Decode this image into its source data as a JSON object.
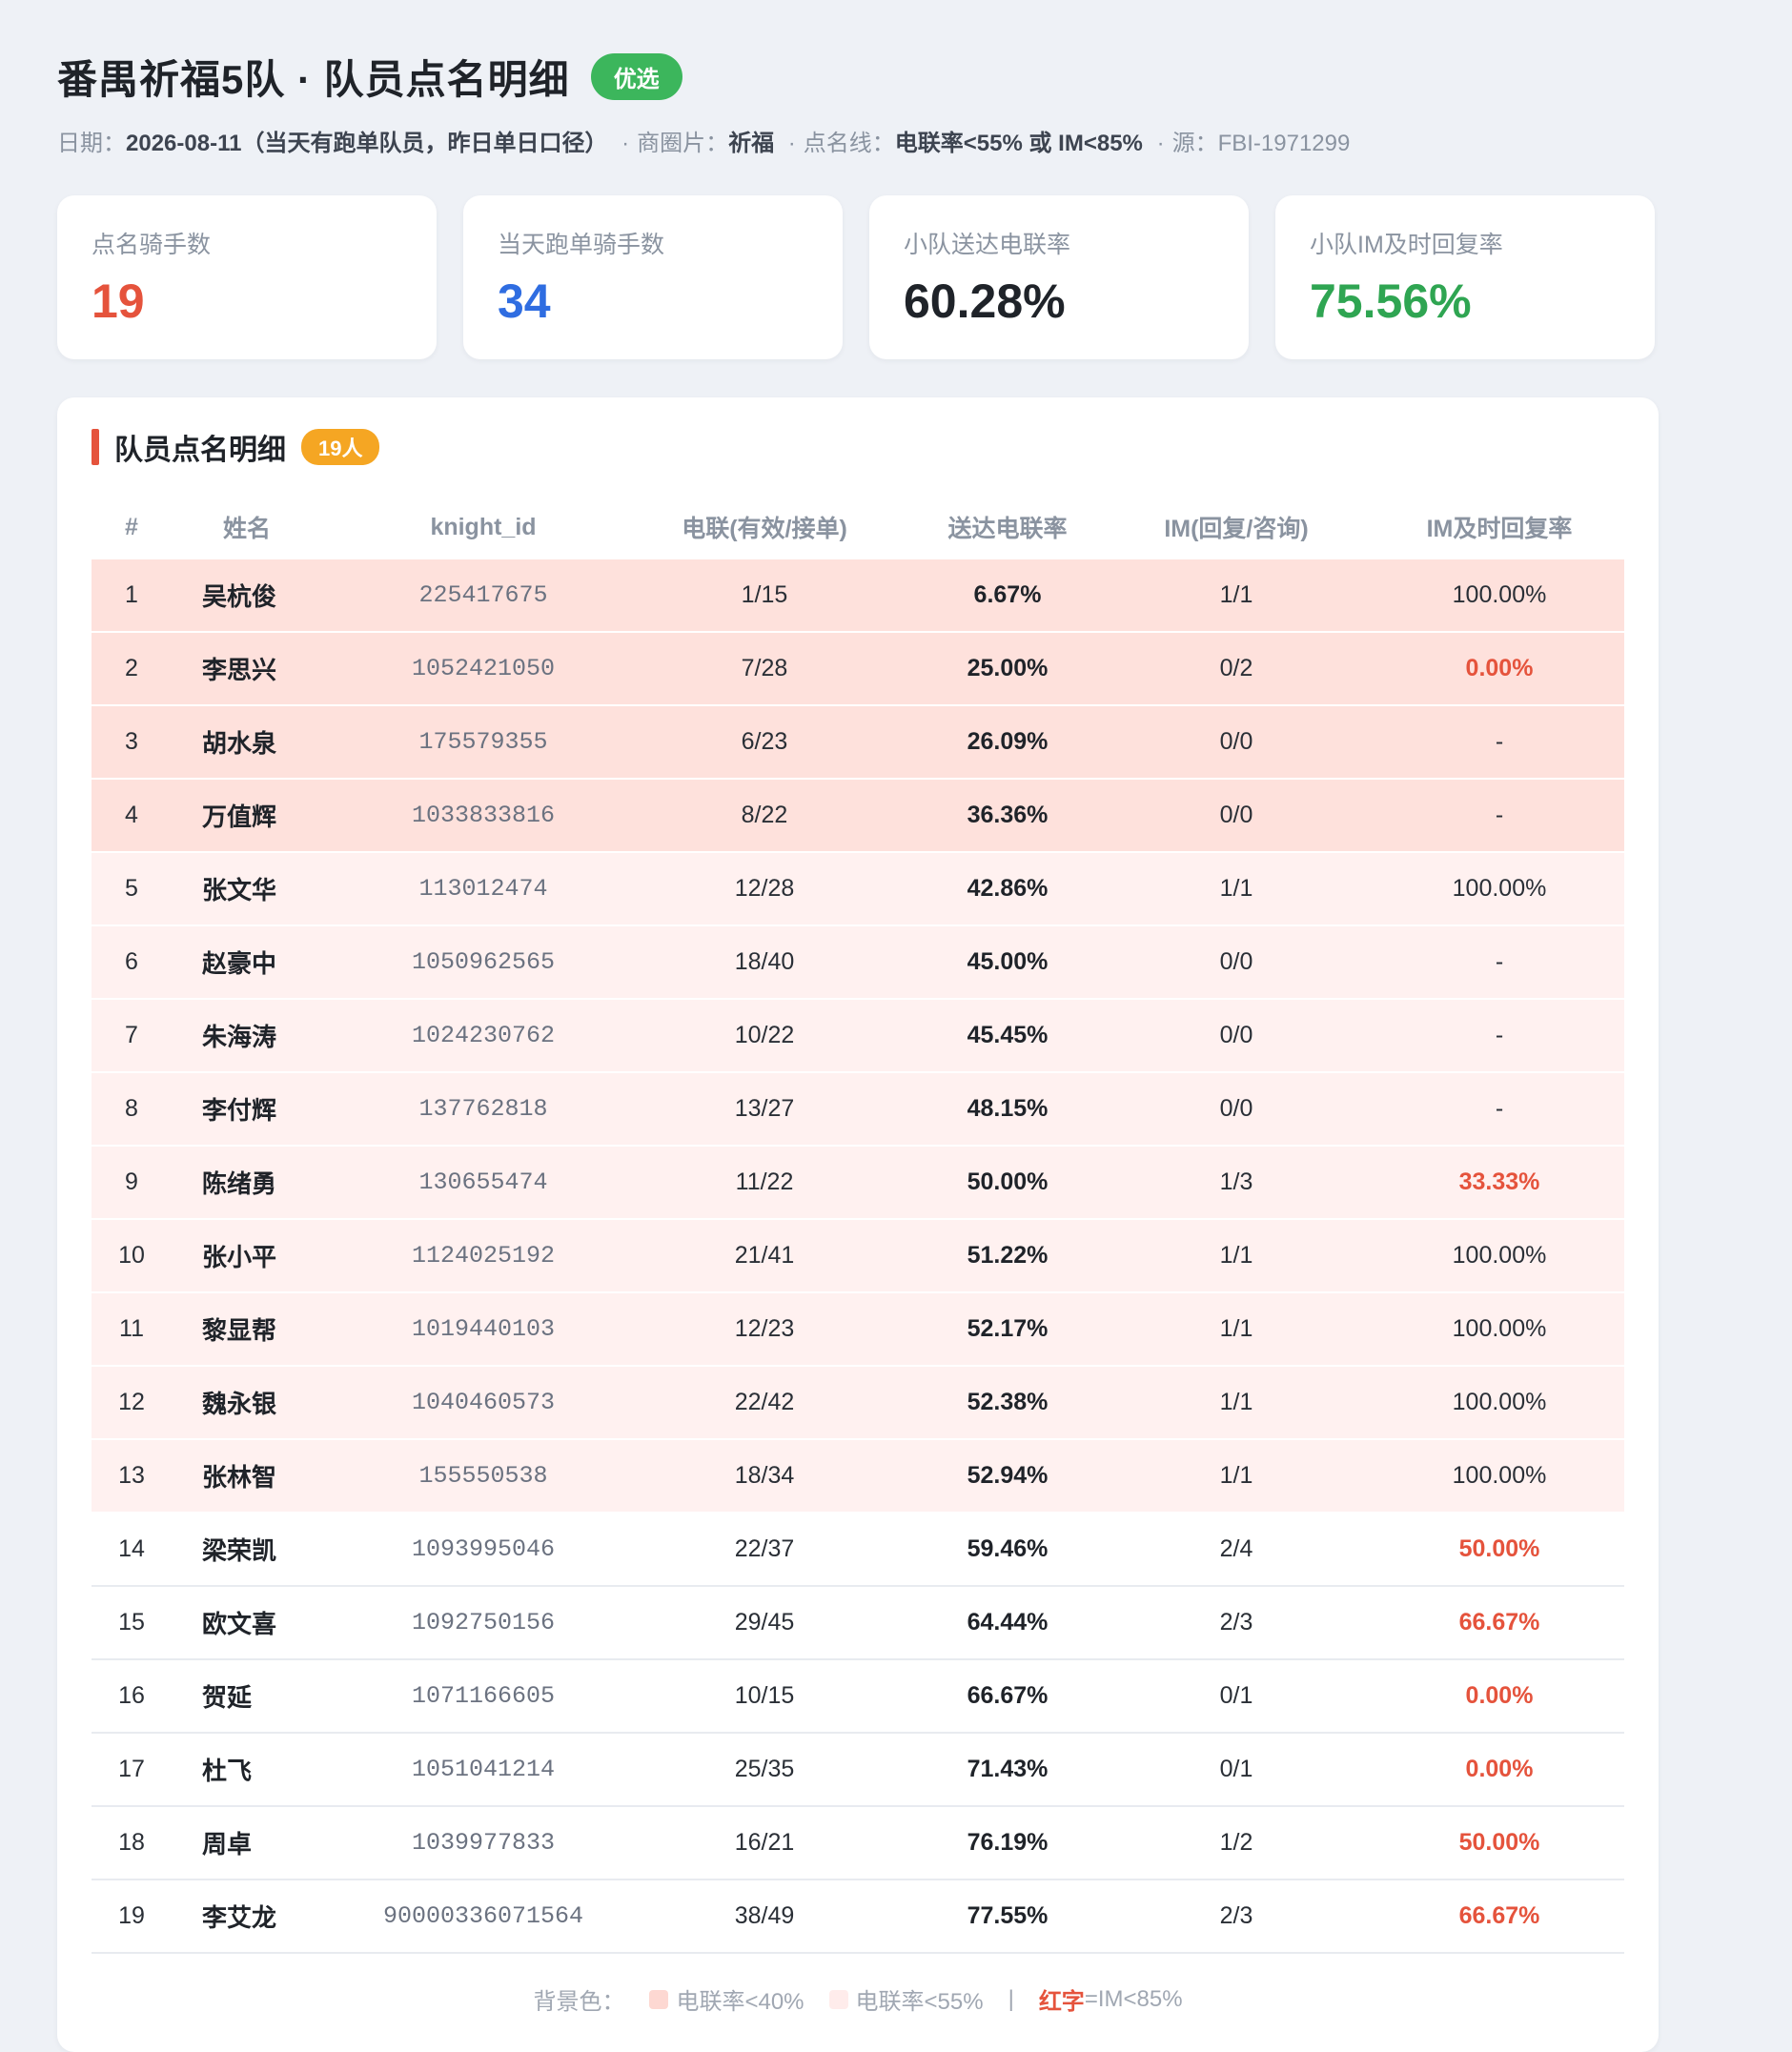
{
  "header": {
    "title": "番禺祈福5队 · 队员点名明细",
    "badge": "优选",
    "meta": {
      "date_label": "日期：",
      "date_value": "2026-08-11（当天有跑单队员，昨日单日口径）",
      "area_label": "商圈片：",
      "area_value": "祈福",
      "threshold_label": "点名线：",
      "threshold_value": "电联率<55% 或 IM<85%",
      "source_label": "源：",
      "source_value": "FBI-1971299",
      "separator": "·"
    }
  },
  "cards": [
    {
      "label": "点名骑手数",
      "value": "19",
      "color": "#e5533c"
    },
    {
      "label": "当天跑单骑手数",
      "value": "34",
      "color": "#2f6de1"
    },
    {
      "label": "小队送达电联率",
      "value": "60.28%",
      "color": "#1f2329"
    },
    {
      "label": "小队IM及时回复率",
      "value": "75.56%",
      "color": "#2fa552"
    }
  ],
  "panel": {
    "title": "队员点名明细",
    "count_badge": "19人",
    "columns": [
      "#",
      "姓名",
      "knight_id",
      "电联(有效/接单)",
      "送达电联率",
      "IM(回复/咨询)",
      "IM及时回复率"
    ],
    "rows": [
      {
        "no": "1",
        "name": "吴杭俊",
        "knight_id": "225417675",
        "call": "1/15",
        "call_rate": "6.67%",
        "im": "1/1",
        "im_rate": "100.00%",
        "bg": "red",
        "im_warn": false
      },
      {
        "no": "2",
        "name": "李思兴",
        "knight_id": "1052421050",
        "call": "7/28",
        "call_rate": "25.00%",
        "im": "0/2",
        "im_rate": "0.00%",
        "bg": "red",
        "im_warn": true
      },
      {
        "no": "3",
        "name": "胡水泉",
        "knight_id": "175579355",
        "call": "6/23",
        "call_rate": "26.09%",
        "im": "0/0",
        "im_rate": "-",
        "bg": "red",
        "im_warn": false
      },
      {
        "no": "4",
        "name": "万值辉",
        "knight_id": "1033833816",
        "call": "8/22",
        "call_rate": "36.36%",
        "im": "0/0",
        "im_rate": "-",
        "bg": "red",
        "im_warn": false
      },
      {
        "no": "5",
        "name": "张文华",
        "knight_id": "113012474",
        "call": "12/28",
        "call_rate": "42.86%",
        "im": "1/1",
        "im_rate": "100.00%",
        "bg": "pink",
        "im_warn": false
      },
      {
        "no": "6",
        "name": "赵豪中",
        "knight_id": "1050962565",
        "call": "18/40",
        "call_rate": "45.00%",
        "im": "0/0",
        "im_rate": "-",
        "bg": "pink",
        "im_warn": false
      },
      {
        "no": "7",
        "name": "朱海涛",
        "knight_id": "1024230762",
        "call": "10/22",
        "call_rate": "45.45%",
        "im": "0/0",
        "im_rate": "-",
        "bg": "pink",
        "im_warn": false
      },
      {
        "no": "8",
        "name": "李付辉",
        "knight_id": "137762818",
        "call": "13/27",
        "call_rate": "48.15%",
        "im": "0/0",
        "im_rate": "-",
        "bg": "pink",
        "im_warn": false
      },
      {
        "no": "9",
        "name": "陈绪勇",
        "knight_id": "130655474",
        "call": "11/22",
        "call_rate": "50.00%",
        "im": "1/3",
        "im_rate": "33.33%",
        "bg": "pink",
        "im_warn": true
      },
      {
        "no": "10",
        "name": "张小平",
        "knight_id": "1124025192",
        "call": "21/41",
        "call_rate": "51.22%",
        "im": "1/1",
        "im_rate": "100.00%",
        "bg": "pink",
        "im_warn": false
      },
      {
        "no": "11",
        "name": "黎显帮",
        "knight_id": "1019440103",
        "call": "12/23",
        "call_rate": "52.17%",
        "im": "1/1",
        "im_rate": "100.00%",
        "bg": "pink",
        "im_warn": false
      },
      {
        "no": "12",
        "name": "魏永银",
        "knight_id": "1040460573",
        "call": "22/42",
        "call_rate": "52.38%",
        "im": "1/1",
        "im_rate": "100.00%",
        "bg": "pink",
        "im_warn": false
      },
      {
        "no": "13",
        "name": "张林智",
        "knight_id": "155550538",
        "call": "18/34",
        "call_rate": "52.94%",
        "im": "1/1",
        "im_rate": "100.00%",
        "bg": "pink",
        "im_warn": false
      },
      {
        "no": "14",
        "name": "梁荣凯",
        "knight_id": "1093995046",
        "call": "22/37",
        "call_rate": "59.46%",
        "im": "2/4",
        "im_rate": "50.00%",
        "bg": "plain",
        "im_warn": true
      },
      {
        "no": "15",
        "name": "欧文喜",
        "knight_id": "1092750156",
        "call": "29/45",
        "call_rate": "64.44%",
        "im": "2/3",
        "im_rate": "66.67%",
        "bg": "plain",
        "im_warn": true
      },
      {
        "no": "16",
        "name": "贺延",
        "knight_id": "1071166605",
        "call": "10/15",
        "call_rate": "66.67%",
        "im": "0/1",
        "im_rate": "0.00%",
        "bg": "plain",
        "im_warn": true
      },
      {
        "no": "17",
        "name": "杜飞",
        "knight_id": "1051041214",
        "call": "25/35",
        "call_rate": "71.43%",
        "im": "0/1",
        "im_rate": "0.00%",
        "bg": "plain",
        "im_warn": true
      },
      {
        "no": "18",
        "name": "周卓",
        "knight_id": "1039977833",
        "call": "16/21",
        "call_rate": "76.19%",
        "im": "1/2",
        "im_rate": "50.00%",
        "bg": "plain",
        "im_warn": true
      },
      {
        "no": "19",
        "name": "李艾龙",
        "knight_id": "90000336071564",
        "call": "38/49",
        "call_rate": "77.55%",
        "im": "2/3",
        "im_rate": "66.67%",
        "bg": "plain",
        "im_warn": true
      }
    ]
  },
  "legend": {
    "prefix": "背景色：",
    "item_red": "电联率<40%",
    "item_pink": "电联率<55%",
    "pipe": "|",
    "red_word": "红字",
    "red_rule": "=IM<85%",
    "swatch_red": "#fdd8d2",
    "swatch_pink": "#ffeceb"
  }
}
